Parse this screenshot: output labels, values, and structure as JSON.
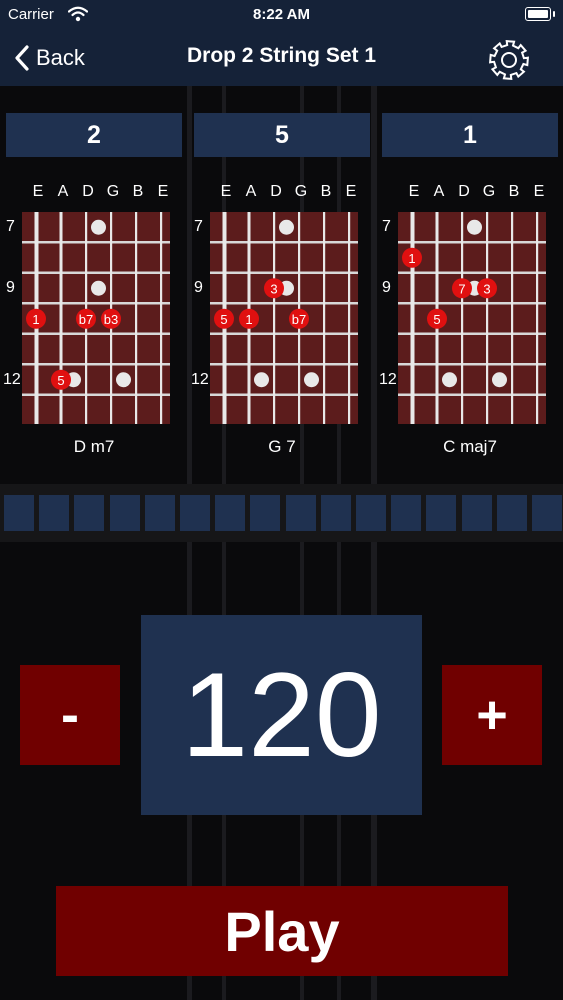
{
  "status_bar": {
    "carrier": "Carrier",
    "time": "8:22 AM"
  },
  "nav": {
    "back_label": "Back",
    "title": "Drop 2 String Set 1"
  },
  "string_names": [
    "E",
    "A",
    "D",
    "G",
    "B",
    "E"
  ],
  "fret_numbers": [
    "7",
    "9",
    "12"
  ],
  "chords": [
    {
      "number": "2",
      "name": "D m7",
      "markers": [
        {
          "label": "1",
          "string": 0,
          "fret": 10
        },
        {
          "label": "b7",
          "string": 2,
          "fret": 10
        },
        {
          "label": "b3",
          "string": 3,
          "fret": 10
        },
        {
          "label": "5",
          "string": 1,
          "fret": 12
        }
      ]
    },
    {
      "number": "5",
      "name": "G 7",
      "markers": [
        {
          "label": "3",
          "string": 2,
          "fret": 9
        },
        {
          "label": "5",
          "string": 0,
          "fret": 10
        },
        {
          "label": "1",
          "string": 1,
          "fret": 10
        },
        {
          "label": "b7",
          "string": 3,
          "fret": 10
        }
      ]
    },
    {
      "number": "1",
      "name": "C maj7",
      "markers": [
        {
          "label": "1",
          "string": 0,
          "fret": 8
        },
        {
          "label": "7",
          "string": 2,
          "fret": 9
        },
        {
          "label": "3",
          "string": 3,
          "fret": 9
        },
        {
          "label": "5",
          "string": 1,
          "fret": 10
        }
      ]
    }
  ],
  "beat_cells": 16,
  "tempo": {
    "value": "120",
    "minus_label": "-",
    "plus_label": "+"
  },
  "play_label": "Play",
  "colors": {
    "bar": "#152238",
    "panel": "#1f3150",
    "fretboard": "#5c1c1c",
    "marker": "#e01010",
    "button": "#700000"
  },
  "icons": [
    "wifi-icon",
    "battery-icon",
    "chevron-left-icon",
    "gear-icon"
  ]
}
